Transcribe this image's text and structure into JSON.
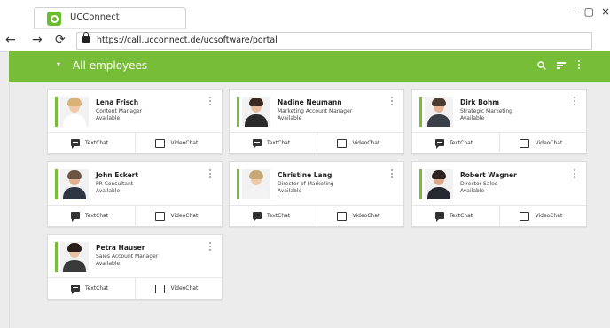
{
  "browser": {
    "tab_title": "UCConnect",
    "url": "https://call.ucconnect.de/ucsoftware/portal",
    "window_controls": [
      "–",
      "▢",
      "×"
    ],
    "nav": {
      "back": "←",
      "forward": "→",
      "reload": "⟳"
    }
  },
  "header": {
    "title": "All employees",
    "caret": "▾",
    "icons": [
      "search-icon",
      "sort-icon",
      "more-vert-icon"
    ]
  },
  "colors": {
    "accent": "#77bd38",
    "favicon": "#6cbd2e"
  },
  "action_labels": {
    "text": "TextChat",
    "video": "VideoChat"
  },
  "employees": [
    {
      "name": "Lena Frisch",
      "role": "Content Manager",
      "status": "Available"
    },
    {
      "name": "Nadine Neumann",
      "role": "Marketing Account Manager",
      "status": "Available"
    },
    {
      "name": "Dirk Bohm",
      "role": "Strategic Marketing",
      "status": "Available"
    },
    {
      "name": "John Eckert",
      "role": "PR Consultant",
      "status": "Available"
    },
    {
      "name": "Christine Lang",
      "role": "Director of Marketing",
      "status": "Available"
    },
    {
      "name": "Robert Wagner",
      "role": "Director Sales",
      "status": "Available"
    },
    {
      "name": "Petra Hauser",
      "role": "Sales Account Manager",
      "status": "Available"
    }
  ]
}
